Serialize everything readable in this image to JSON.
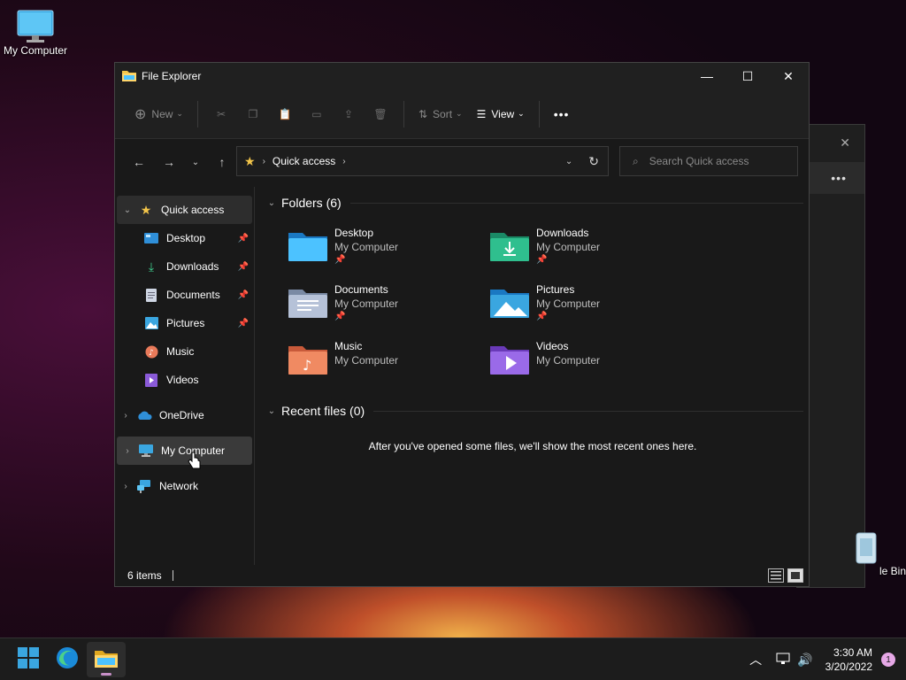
{
  "desktop": {
    "icons": [
      {
        "label": "My Computer",
        "icon": "monitor-icon"
      },
      {
        "label": "le Bin",
        "icon": "recycle-bin-icon"
      }
    ]
  },
  "window": {
    "title": "File Explorer",
    "toolbar": {
      "new_label": "New",
      "sort_label": "Sort",
      "view_label": "View",
      "more_label": "•••"
    },
    "address": {
      "path": "Quick access",
      "search_placeholder": "Search Quick access"
    },
    "sidebar": {
      "items": [
        {
          "label": "Quick access",
          "icon": "star-icon"
        },
        {
          "label": "Desktop",
          "icon": "desktop-folder-icon"
        },
        {
          "label": "Downloads",
          "icon": "download-icon"
        },
        {
          "label": "Documents",
          "icon": "document-icon"
        },
        {
          "label": "Pictures",
          "icon": "pictures-icon"
        },
        {
          "label": "Music",
          "icon": "music-icon"
        },
        {
          "label": "Videos",
          "icon": "videos-icon"
        },
        {
          "label": "OneDrive",
          "icon": "cloud-icon"
        },
        {
          "label": "My Computer",
          "icon": "monitor-icon"
        },
        {
          "label": "Network",
          "icon": "network-icon"
        }
      ]
    },
    "content": {
      "folders_header": "Folders (6)",
      "folders": [
        {
          "name": "Desktop",
          "location": "My Computer",
          "pinned": true
        },
        {
          "name": "Downloads",
          "location": "My Computer",
          "pinned": true
        },
        {
          "name": "Documents",
          "location": "My Computer",
          "pinned": true
        },
        {
          "name": "Pictures",
          "location": "My Computer",
          "pinned": true
        },
        {
          "name": "Music",
          "location": "My Computer",
          "pinned": false
        },
        {
          "name": "Videos",
          "location": "My Computer",
          "pinned": false
        }
      ],
      "recent_header": "Recent files (0)",
      "recent_empty": "After you've opened some files, we'll show the most recent ones here."
    },
    "status": {
      "item_count": "6 items"
    }
  },
  "taskbar": {
    "time": "3:30 AM",
    "date": "3/20/2022",
    "notification_count": "1"
  },
  "colors": {
    "accent": "#4cc2ff",
    "folder_yellow": "#f3c54a",
    "window_bg": "#191919"
  }
}
